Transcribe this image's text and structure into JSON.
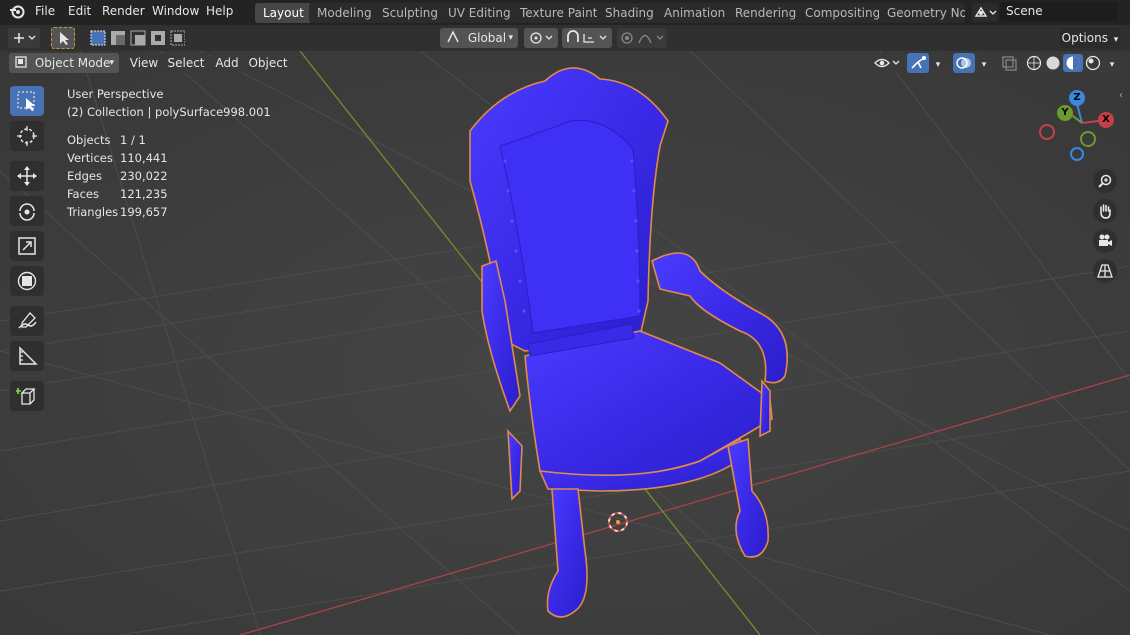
{
  "topbar": {
    "menu": [
      "File",
      "Edit",
      "Render",
      "Window",
      "Help"
    ],
    "workspaces": [
      {
        "label": "Layout",
        "active": true
      },
      {
        "label": "Modeling"
      },
      {
        "label": "Sculpting"
      },
      {
        "label": "UV Editing"
      },
      {
        "label": "Texture Paint"
      },
      {
        "label": "Shading"
      },
      {
        "label": "Animation"
      },
      {
        "label": "Rendering"
      },
      {
        "label": "Compositing"
      },
      {
        "label": "Geometry Nod"
      }
    ],
    "scene": "Scene"
  },
  "header": {
    "transform_orientation": "Global",
    "options_label": "Options"
  },
  "viewport_header": {
    "mode": "Object Mode",
    "menus": [
      "View",
      "Select",
      "Add",
      "Object"
    ]
  },
  "overlay": {
    "view_name": "User Perspective",
    "collection": "(2) Collection | polySurface998.001",
    "stats": [
      {
        "label": "Objects",
        "value": "1 / 1"
      },
      {
        "label": "Vertices",
        "value": "110,441"
      },
      {
        "label": "Edges",
        "value": "230,022"
      },
      {
        "label": "Faces",
        "value": "121,235"
      },
      {
        "label": "Triangles",
        "value": "199,657"
      }
    ]
  },
  "gizmo": {
    "x": "X",
    "y": "Y",
    "z": "Z"
  },
  "colors": {
    "accent": "#4772b3",
    "object": "#3f2ff0",
    "outline": "#e08a4a",
    "x_axis": "#c6404a",
    "y_axis": "#6b9b2a",
    "z_axis": "#3b86e0"
  }
}
